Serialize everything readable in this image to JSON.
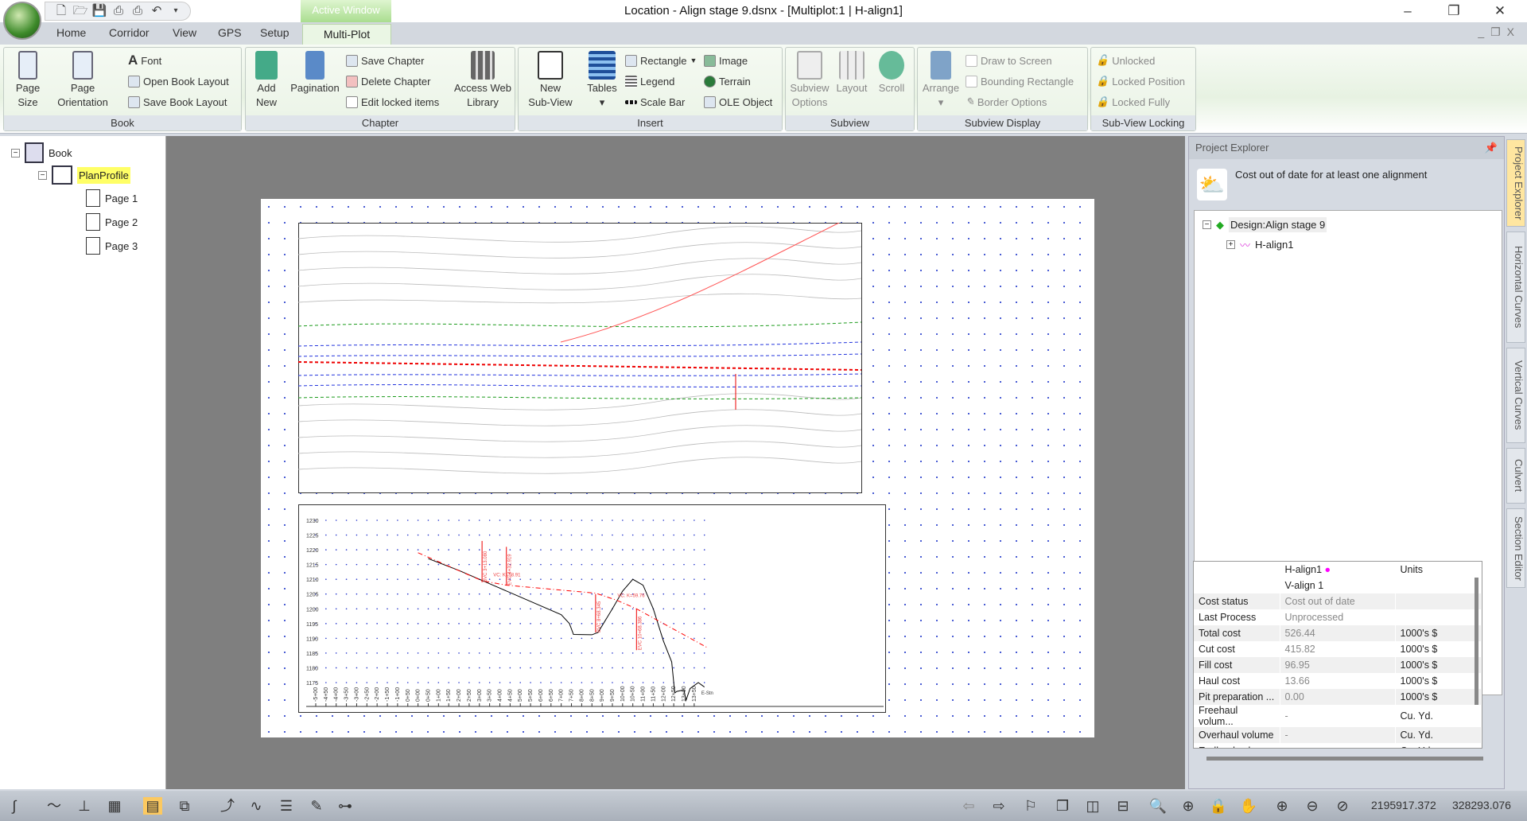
{
  "title_bar": {
    "window_title": "Location - Align stage 9.dsnx - [Multiplot:1 | H-align1]",
    "context_tab": "Active Window",
    "controls": {
      "minimize": "–",
      "restore": "❐",
      "close": "✕"
    }
  },
  "quick_access": [
    "new-icon",
    "open-icon",
    "save-icon",
    "print-icon",
    "print-preview-icon",
    "undo-icon"
  ],
  "tabs": [
    {
      "label": "Home"
    },
    {
      "label": "Corridor"
    },
    {
      "label": "View"
    },
    {
      "label": "GPS"
    },
    {
      "label": "Setup"
    },
    {
      "label": "Multi-Plot",
      "active": true
    }
  ],
  "ribbon": {
    "book": {
      "label": "Book",
      "page_size": "Page",
      "page_size2": "Size",
      "page_orientation": "Page",
      "page_orientation2": "Orientation",
      "font": "Font",
      "open_layout": "Open Book Layout",
      "save_layout": "Save Book Layout"
    },
    "chapter": {
      "label": "Chapter",
      "add_new": "Add",
      "add_new2": "New",
      "pagination": "Pagination",
      "save_chapter": "Save Chapter",
      "delete_chapter": "Delete Chapter",
      "edit_locked": "Edit locked items",
      "access_web": "Access Web",
      "access_web2": "Library"
    },
    "insert": {
      "label": "Insert",
      "new_subview": "New",
      "new_subview2": "Sub-View",
      "tables": "Tables",
      "rectangle": "Rectangle",
      "legend": "Legend",
      "scale_bar": "Scale Bar",
      "image": "Image",
      "terrain": "Terrain",
      "ole": "OLE Object"
    },
    "subview": {
      "label": "Subview",
      "options": "Subview",
      "options2": "Options",
      "layout": "Layout",
      "scroll": "Scroll"
    },
    "subview_display": {
      "label": "Subview Display",
      "arrange": "Arrange",
      "draw_to_screen": "Draw to Screen",
      "bounding_rect": "Bounding Rectangle",
      "border_options": "Border Options"
    },
    "locking": {
      "label": "Sub-View Locking",
      "unlocked": "Unlocked",
      "locked_position": "Locked Position",
      "locked_fully": "Locked Fully"
    }
  },
  "book_tree": {
    "root": "Book",
    "chapter": "PlanProfile",
    "pages": [
      "Page 1",
      "Page 2",
      "Page 3"
    ]
  },
  "project_explorer": {
    "title": "Project Explorer",
    "status_message": "Cost out of date for at least one alignment",
    "design": "Design:Align stage 9",
    "alignment": "H-align1"
  },
  "properties": {
    "header": {
      "col1": "H-align1",
      "col1b": "V-align 1",
      "units": "Units",
      "marker_color": "#ff00ff"
    },
    "rows": [
      {
        "name": "Cost status",
        "value": "Cost out of date",
        "unit": ""
      },
      {
        "name": "Last Process",
        "value": "Unprocessed",
        "unit": ""
      },
      {
        "name": "Total cost",
        "value": "526.44",
        "unit": "1000's $"
      },
      {
        "name": "Cut cost",
        "value": "415.82",
        "unit": "1000's $"
      },
      {
        "name": "Fill cost",
        "value": "96.95",
        "unit": "1000's $"
      },
      {
        "name": "Haul cost",
        "value": "13.66",
        "unit": "1000's $"
      },
      {
        "name": "Pit preparation ...",
        "value": "0.00",
        "unit": "1000's $"
      },
      {
        "name": "Freehaul volum...",
        "value": "-",
        "unit": "Cu. Yd."
      },
      {
        "name": "Overhaul volume",
        "value": "-",
        "unit": "Cu. Yd."
      },
      {
        "name": "Endhaul volume",
        "value": "-",
        "unit": "Cu. Yd."
      }
    ]
  },
  "side_tabs": [
    "Project Explorer",
    "Horizontal Curves",
    "Vertical Curves",
    "Culvert",
    "Section Editor"
  ],
  "status_bar": {
    "x_coord": "2195917.372",
    "y_coord": "328293.076"
  },
  "chart_data": {
    "type": "line",
    "title": "",
    "xlabel": "",
    "ylabel": "",
    "y_ticks": [
      1175,
      1180,
      1185,
      1190,
      1195,
      1200,
      1205,
      1210,
      1215,
      1220,
      1225,
      1230
    ],
    "x_tick_labels": [
      "-5+00",
      "-4+50",
      "-4+00",
      "-3+50",
      "-3+00",
      "-2+50",
      "-2+00",
      "-1+50",
      "-1+00",
      "0+50",
      "0+00",
      "0+50",
      "1+00",
      "1+50",
      "2+00",
      "2+50",
      "3+00",
      "3+50",
      "4+00",
      "4+50",
      "5+00",
      "5+50",
      "6+00",
      "6+50",
      "7+00",
      "7+50",
      "8+00",
      "8+50",
      "9+00",
      "9+50",
      "10+00",
      "10+50",
      "11+00",
      "11+50",
      "12+00",
      "12+50",
      "13+00",
      "13+50"
    ],
    "xlim": [
      -500,
      1400
    ],
    "ylim": [
      1170,
      1233
    ],
    "series": [
      {
        "role": "ground",
        "color": "#000000",
        "x": [
          50,
          200,
          300,
          400,
          500,
          600,
          700,
          740,
          760,
          850,
          880,
          950,
          1000,
          1050,
          1100,
          1150,
          1200,
          1240,
          1255,
          1265,
          1300,
          1310,
          1330,
          1370,
          1400
        ],
        "y": [
          1217,
          1213,
          1210,
          1207,
          1204,
          1201,
          1198,
          1195,
          1191.3,
          1191.2,
          1192,
          1200,
          1206,
          1210,
          1208,
          1200,
          1189,
          1182,
          1171.5,
          1172,
          1172.5,
          1169,
          1173,
          1175,
          1173.5
        ]
      },
      {
        "role": "design",
        "color": "#ff0000",
        "x": [
          0,
          313,
          433,
          868,
          968,
          1068,
          1410
        ],
        "y": [
          1219,
          1209.5,
          1208,
          1205.3,
          1203,
          1200,
          1187
        ]
      }
    ],
    "annotations": [
      "BVC 3+13.080",
      "EVC 4+32.919",
      "VC: K=58.91",
      "BVC 8+68.345",
      "VC: K=59.76",
      "EVC 10+68.386",
      "E-Stn"
    ]
  }
}
